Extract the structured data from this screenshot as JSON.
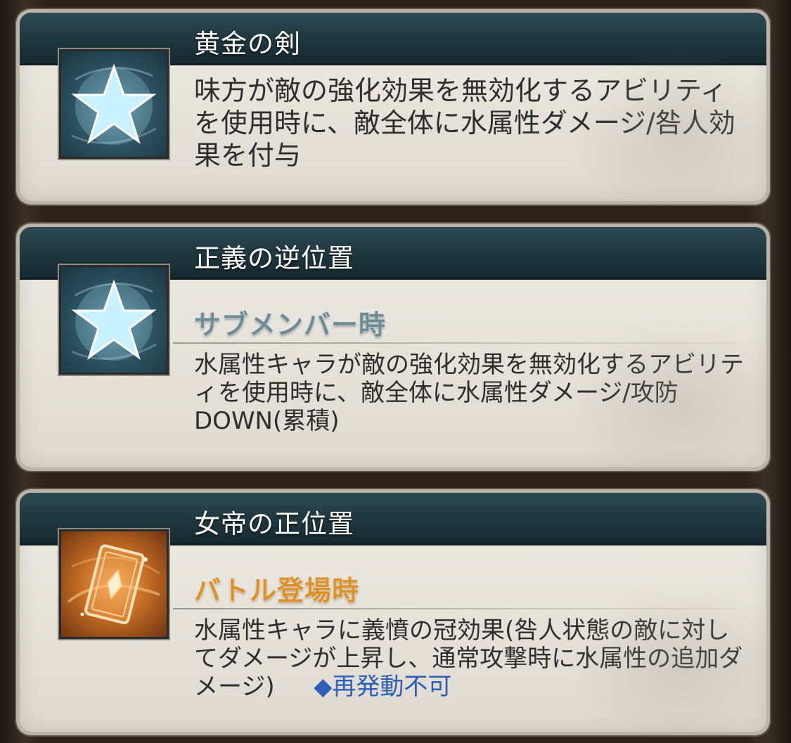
{
  "cards": [
    {
      "title": "黄金の剣",
      "icon": "star-icon",
      "description": "味方が敵の強化効果を無効化するアビリティを使用時に、敵全体に水属性ダメージ/咎人効果を付与"
    },
    {
      "title": "正義の逆位置",
      "icon": "star-icon",
      "condition": "サブメンバー時",
      "description": "水属性キャラが敵の強化効果を無効化するアビリティを使用時に、敵全体に水属性ダメージ/攻防DOWN(累積)"
    },
    {
      "title": "女帝の正位置",
      "icon": "tarot-card-icon",
      "condition": "バトル登場時",
      "description": "水属性キャラに義憤の冠効果(咎人状態の敵に対してダメージが上昇し、通常攻撃時に水属性の追加ダメージ)",
      "note": "◆再発動不可"
    }
  ],
  "colors": {
    "header": "#1d353d",
    "condition_blue": "#6d8c93",
    "condition_orange": "#d9922c",
    "note_blue": "#2c5fb7"
  }
}
